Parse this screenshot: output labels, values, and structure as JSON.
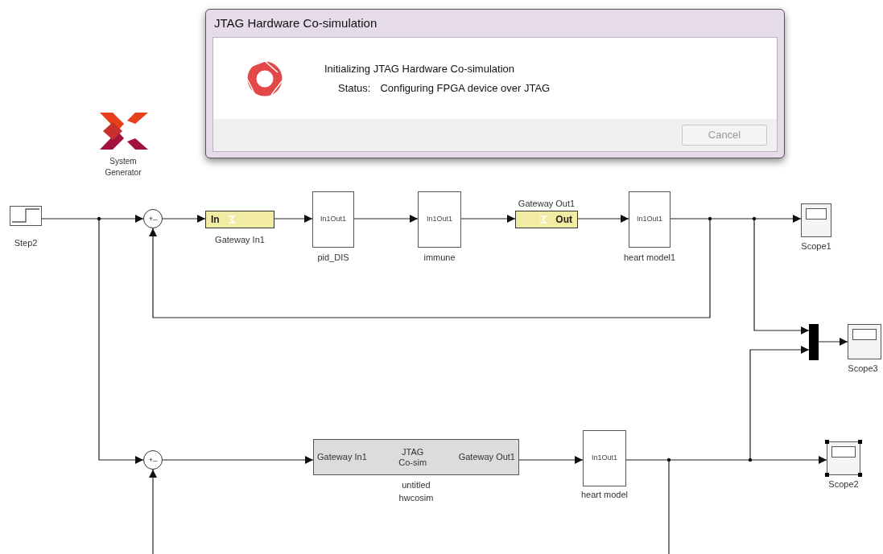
{
  "dialog": {
    "title": "JTAG Hardware Co-simulation",
    "message": "Initializing JTAG Hardware Co-simulation",
    "status_label": "Status:",
    "status_value": "Configuring FPGA device over JTAG",
    "cancel_button": {
      "label": "Cancel",
      "disabled": true
    }
  },
  "logo": {
    "label": "System Generator"
  },
  "blocks": [
    {
      "kind": "step",
      "label": "Step2",
      "selected": false
    },
    {
      "kind": "sum",
      "signs": [
        "+",
        "_"
      ]
    },
    {
      "kind": "gateway",
      "text": "In",
      "label": "Gateway In1"
    },
    {
      "kind": "subsystem",
      "ports": [
        "In1",
        "Out1"
      ],
      "label": "pid_DIS"
    },
    {
      "kind": "subsystem",
      "ports": [
        "In1",
        "Out1"
      ],
      "label": "immune"
    },
    {
      "kind": "gateway",
      "text": "Out",
      "label": "Gateway Out1"
    },
    {
      "kind": "subsystem",
      "ports": [
        "In1",
        "Out1"
      ],
      "label": "heart model1"
    },
    {
      "kind": "scope",
      "label": "Scope1",
      "selected": false
    },
    {
      "kind": "mux"
    },
    {
      "kind": "scope",
      "label": "Scope3",
      "selected": false
    },
    {
      "kind": "sum",
      "signs": [
        "+",
        "_"
      ]
    },
    {
      "kind": "hwcosim",
      "ports": [
        "Gateway In1",
        "Gateway Out1"
      ],
      "title": "JTAG Co-sim",
      "label": "untitled hwcosim"
    },
    {
      "kind": "subsystem",
      "ports": [
        "In1",
        "Out1"
      ],
      "label": "heart model"
    },
    {
      "kind": "scope",
      "label": "Scope2",
      "selected": true
    }
  ]
}
